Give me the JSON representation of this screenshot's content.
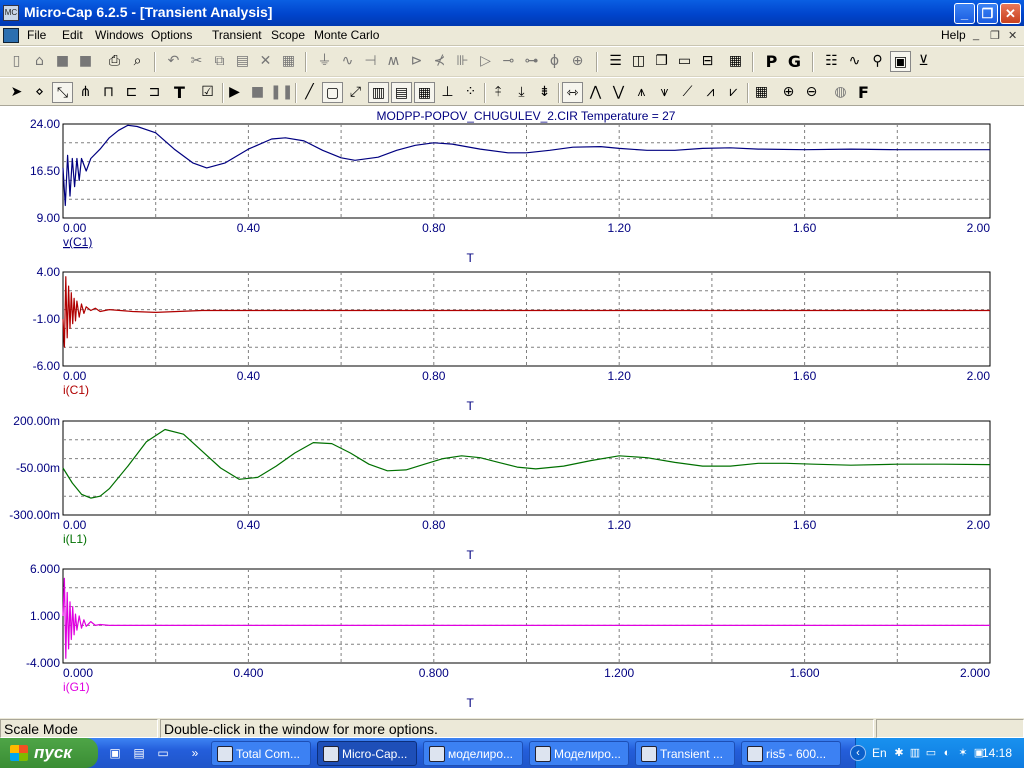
{
  "window": {
    "title": "Micro-Cap 6.2.5 - [Transient Analysis]"
  },
  "menu": {
    "items": [
      "File",
      "Edit",
      "Windows",
      "Options",
      "Transient",
      "Scope",
      "Monte Carlo"
    ],
    "help": "Help"
  },
  "toolbar1": {
    "p_label": "P",
    "g_label": "G"
  },
  "toolbar2": {
    "t_label": "T",
    "f_label": "F"
  },
  "analysis_title": "MODPP-POPOV_CHUGULEV_2.CIR Temperature = 27",
  "colors": {
    "trace1": "#000080",
    "trace2": "#b00000",
    "trace3": "#007000",
    "trace4": "#e000e0",
    "grid": "#808080"
  },
  "chart_data": [
    {
      "type": "line",
      "series": [
        {
          "name": "v(C1)",
          "color": "#000080"
        }
      ],
      "xlabel": "T",
      "ylim": [
        9.0,
        24.0
      ],
      "yticks": [
        "24.00",
        "16.50",
        "9.00"
      ],
      "xticks": [
        "0.00",
        "0.40",
        "0.80",
        "1.20",
        "1.60",
        "2.00"
      ],
      "xlim": [
        0,
        2.0
      ],
      "x": [
        0.0,
        0.005,
        0.01,
        0.015,
        0.02,
        0.025,
        0.03,
        0.035,
        0.04,
        0.05,
        0.06,
        0.08,
        0.1,
        0.12,
        0.14,
        0.16,
        0.2,
        0.24,
        0.28,
        0.31,
        0.35,
        0.4,
        0.45,
        0.48,
        0.52,
        0.56,
        0.6,
        0.63,
        0.68,
        0.72,
        0.76,
        0.8,
        0.84,
        0.9,
        0.96,
        1.0,
        1.05,
        1.1,
        1.16,
        1.2,
        1.26,
        1.32,
        1.38,
        1.44,
        1.5,
        1.6,
        1.7,
        1.8,
        1.9,
        2.0
      ],
      "y": [
        17.0,
        11.0,
        19.0,
        12.5,
        18.5,
        14.0,
        18.5,
        15.0,
        18.5,
        16.5,
        18.5,
        20.0,
        21.8,
        23.0,
        23.8,
        23.6,
        22.6,
        20.0,
        17.8,
        17.0,
        17.8,
        20.0,
        21.6,
        21.8,
        21.3,
        19.8,
        18.6,
        18.2,
        18.7,
        19.8,
        20.6,
        21.0,
        20.8,
        20.0,
        19.4,
        19.4,
        19.8,
        20.3,
        20.4,
        20.1,
        19.8,
        19.8,
        20.1,
        20.2,
        20.0,
        19.9,
        20.0,
        19.9,
        19.9,
        19.9
      ]
    },
    {
      "type": "line",
      "series": [
        {
          "name": "i(C1)",
          "color": "#b00000"
        }
      ],
      "xlabel": "T",
      "ylim": [
        -6.0,
        4.0
      ],
      "yticks": [
        "4.00",
        "-1.00",
        "-6.00"
      ],
      "xticks": [
        "0.00",
        "0.40",
        "0.80",
        "1.20",
        "1.60",
        "2.00"
      ],
      "xlim": [
        0,
        2.0
      ],
      "x": [
        0.0,
        0.003,
        0.006,
        0.009,
        0.012,
        0.015,
        0.018,
        0.021,
        0.024,
        0.027,
        0.03,
        0.035,
        0.04,
        0.045,
        0.05,
        0.06,
        0.07,
        0.08,
        0.1,
        0.15,
        0.2,
        0.3,
        0.5,
        0.8,
        1.2,
        1.6,
        2.0
      ],
      "y": [
        -1.0,
        -4.0,
        3.5,
        -3.0,
        2.5,
        -2.0,
        1.8,
        -1.5,
        1.2,
        -1.2,
        0.9,
        -0.8,
        0.6,
        -0.4,
        0.3,
        -0.1,
        0.15,
        -0.2,
        0.0,
        -0.2,
        -0.3,
        -0.1,
        -0.1,
        -0.1,
        -0.1,
        -0.1,
        -0.1
      ]
    },
    {
      "type": "line",
      "series": [
        {
          "name": "i(L1)",
          "color": "#007000"
        }
      ],
      "xlabel": "T",
      "ylim": [
        -300.0,
        200.0
      ],
      "yticks": [
        "200.00m",
        "-50.00m",
        "-300.00m"
      ],
      "xticks": [
        "0.00",
        "0.40",
        "0.80",
        "1.20",
        "1.60",
        "2.00"
      ],
      "xlim": [
        0,
        2.0
      ],
      "x": [
        0.0,
        0.02,
        0.04,
        0.06,
        0.08,
        0.1,
        0.14,
        0.18,
        0.22,
        0.26,
        0.3,
        0.34,
        0.38,
        0.42,
        0.46,
        0.5,
        0.54,
        0.58,
        0.62,
        0.66,
        0.7,
        0.74,
        0.78,
        0.82,
        0.86,
        0.9,
        0.94,
        0.98,
        1.02,
        1.08,
        1.14,
        1.2,
        1.26,
        1.32,
        1.38,
        1.44,
        1.5,
        1.56,
        1.62,
        1.7,
        1.8,
        1.9,
        2.0
      ],
      "y": [
        -50.0,
        -130.0,
        -190.0,
        -210.0,
        -200.0,
        -160.0,
        -40.0,
        90.0,
        155.0,
        130.0,
        40.0,
        -50.0,
        -110.0,
        -100.0,
        -40.0,
        30.0,
        85.0,
        80.0,
        30.0,
        -30.0,
        -65.0,
        -60.0,
        -30.0,
        0.0,
        15.0,
        5.0,
        -20.0,
        -45.0,
        -55.0,
        -40.0,
        -10.0,
        15.0,
        5.0,
        -20.0,
        -40.0,
        -40.0,
        -25.0,
        -25.0,
        -30.0,
        -35.0,
        -30.0,
        -30.0,
        -32.0
      ]
    },
    {
      "type": "line",
      "series": [
        {
          "name": "i(G1)",
          "color": "#e000e0"
        }
      ],
      "xlabel": "T",
      "ylim": [
        -4.0,
        6.0
      ],
      "yticks": [
        "6.000",
        "1.000",
        "-4.000"
      ],
      "xticks": [
        "0.000",
        "0.400",
        "0.800",
        "1.200",
        "1.600",
        "2.000"
      ],
      "xlim": [
        0,
        2.0
      ],
      "x": [
        0.0,
        0.003,
        0.006,
        0.009,
        0.012,
        0.015,
        0.018,
        0.021,
        0.024,
        0.027,
        0.03,
        0.035,
        0.04,
        0.045,
        0.05,
        0.06,
        0.07,
        0.08,
        0.1,
        0.15,
        0.3,
        0.6,
        1.0,
        1.5,
        2.0
      ],
      "y": [
        1.0,
        5.0,
        -3.5,
        3.5,
        -2.5,
        2.5,
        -1.5,
        2.0,
        -1.0,
        1.2,
        -0.5,
        1.0,
        -0.3,
        0.6,
        -0.1,
        0.4,
        0.0,
        0.1,
        0.0,
        0.0,
        0.0,
        0.0,
        0.0,
        0.0,
        0.0
      ]
    }
  ],
  "status": {
    "mode": "Scale Mode",
    "hint": "Double-click in the window for more options."
  },
  "taskbar": {
    "start": "пуск",
    "tasks": [
      "Total Com...",
      "Micro-Cap...",
      "моделиро...",
      "Моделиро...",
      "Transient ...",
      "ris5 - 600..."
    ],
    "lang": "En",
    "clock": "14:18"
  }
}
